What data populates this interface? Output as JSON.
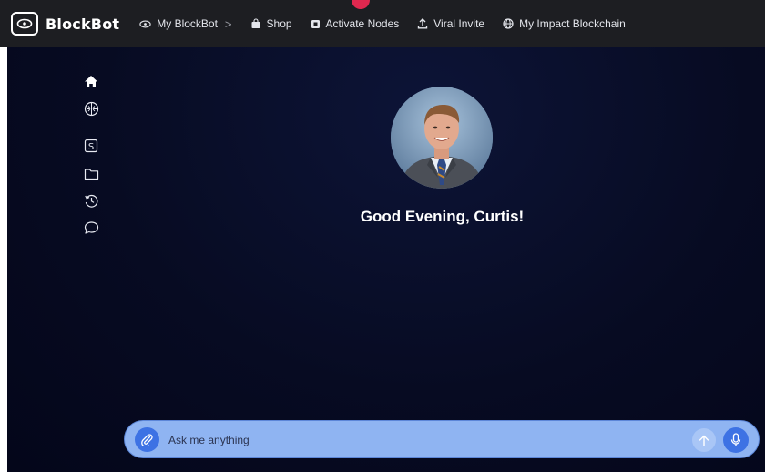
{
  "brand": {
    "name": "BlockBot",
    "logo_icon": "eye-logo-icon"
  },
  "nav": {
    "items": [
      {
        "label": "My BlockBot",
        "icon": "eye-icon",
        "suffix": ">"
      },
      {
        "label": "Shop",
        "icon": "shopping-bag-icon"
      },
      {
        "label": "Activate Nodes",
        "icon": "node-icon"
      },
      {
        "label": "Viral Invite",
        "icon": "upload-icon"
      },
      {
        "label": "My Impact Blockchain",
        "icon": "globe-icon"
      }
    ]
  },
  "sidebar": {
    "items": [
      {
        "icon": "home-icon"
      },
      {
        "icon": "brain-icon"
      },
      {
        "icon": "s-square-icon"
      },
      {
        "icon": "folder-icon"
      },
      {
        "icon": "history-icon"
      },
      {
        "icon": "chat-bubble-icon"
      }
    ]
  },
  "main": {
    "avatar_alt": "profile photo",
    "greeting": "Good Evening, Curtis!"
  },
  "chat": {
    "placeholder": "Ask me anything",
    "value": ""
  },
  "colors": {
    "topbar_bg": "#1d1e22",
    "main_bg": "#070b22",
    "chatbar_bg": "#8fb4f2",
    "accent": "#3d72e4",
    "notch": "#e0284f"
  }
}
